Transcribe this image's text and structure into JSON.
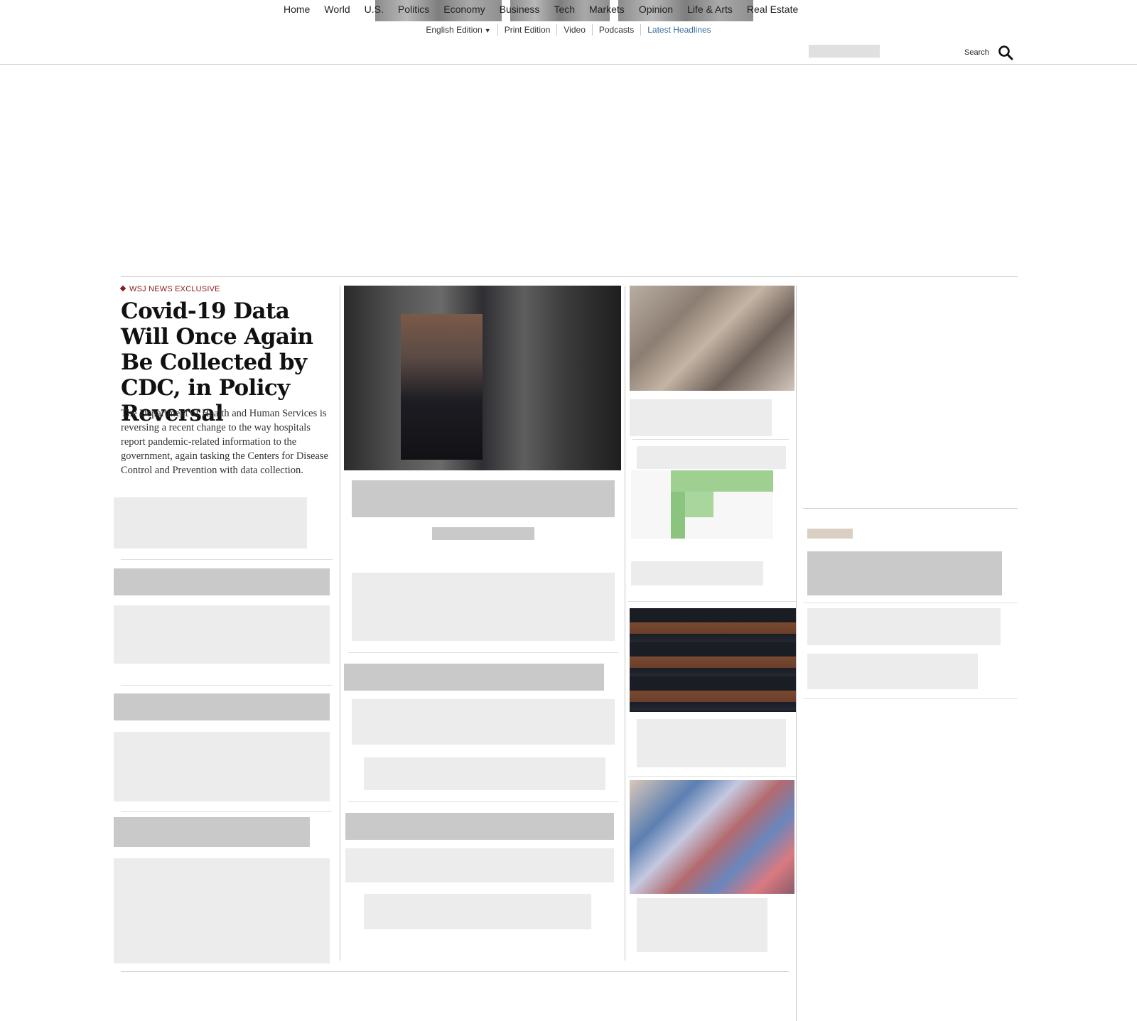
{
  "header": {
    "edition_bar": {
      "english_edition": "English Edition",
      "print_edition": "Print Edition",
      "video": "Video",
      "podcasts": "Podcasts",
      "latest_headlines": "Latest Headlines"
    },
    "nav": [
      "Home",
      "World",
      "U.S.",
      "Politics",
      "Economy",
      "Business",
      "Tech",
      "Markets",
      "Opinion",
      "Life & Arts",
      "Real Estate"
    ],
    "search_label": "Search"
  },
  "lead_story": {
    "flag": "WSJ NEWS EXCLUSIVE",
    "headline": "Covid-19 Data Will Once Again Be Collected by CDC, in Policy Reversal",
    "summary": "The Department of Health and Human Services is reversing a recent change to the way hospitals report pandemic-related information to the government, again tasking the Centers for Disease Control and Prevention with data collection."
  },
  "colors": {
    "flag_red": "#8a1a1a",
    "link_blue": "#3b6f9c",
    "chart_green": "#8ac47e"
  },
  "icons": {
    "search": "magnifier-icon",
    "caret": "caret-down-icon"
  }
}
